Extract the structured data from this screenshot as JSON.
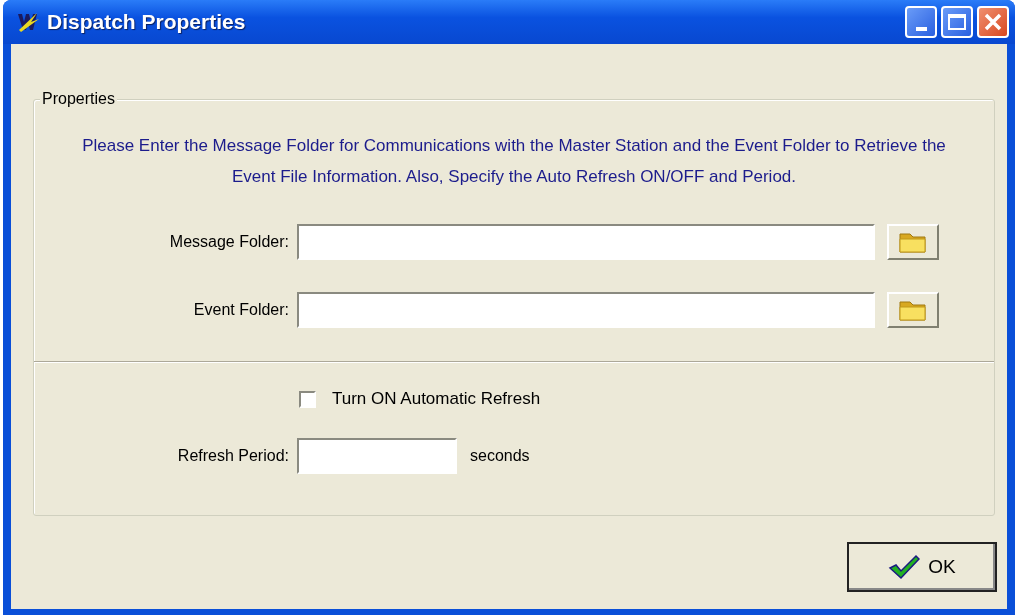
{
  "window": {
    "title": "Dispatch Properties"
  },
  "group": {
    "title": "Properties",
    "description": "Please Enter the Message Folder for Communications with the Master Station and the Event Folder to Retrieve the Event File Information. Also, Specify the Auto Refresh ON/OFF and Period."
  },
  "folders": [
    {
      "label": "Message Folder:"
    },
    {
      "label": "Event Folder:"
    }
  ],
  "auto_refresh": {
    "label": "Turn ON Automatic Refresh",
    "checked": false
  },
  "refresh_period": {
    "label": "Refresh Period:",
    "unit": "seconds"
  },
  "buttons": [
    {
      "label": "OK"
    }
  ]
}
